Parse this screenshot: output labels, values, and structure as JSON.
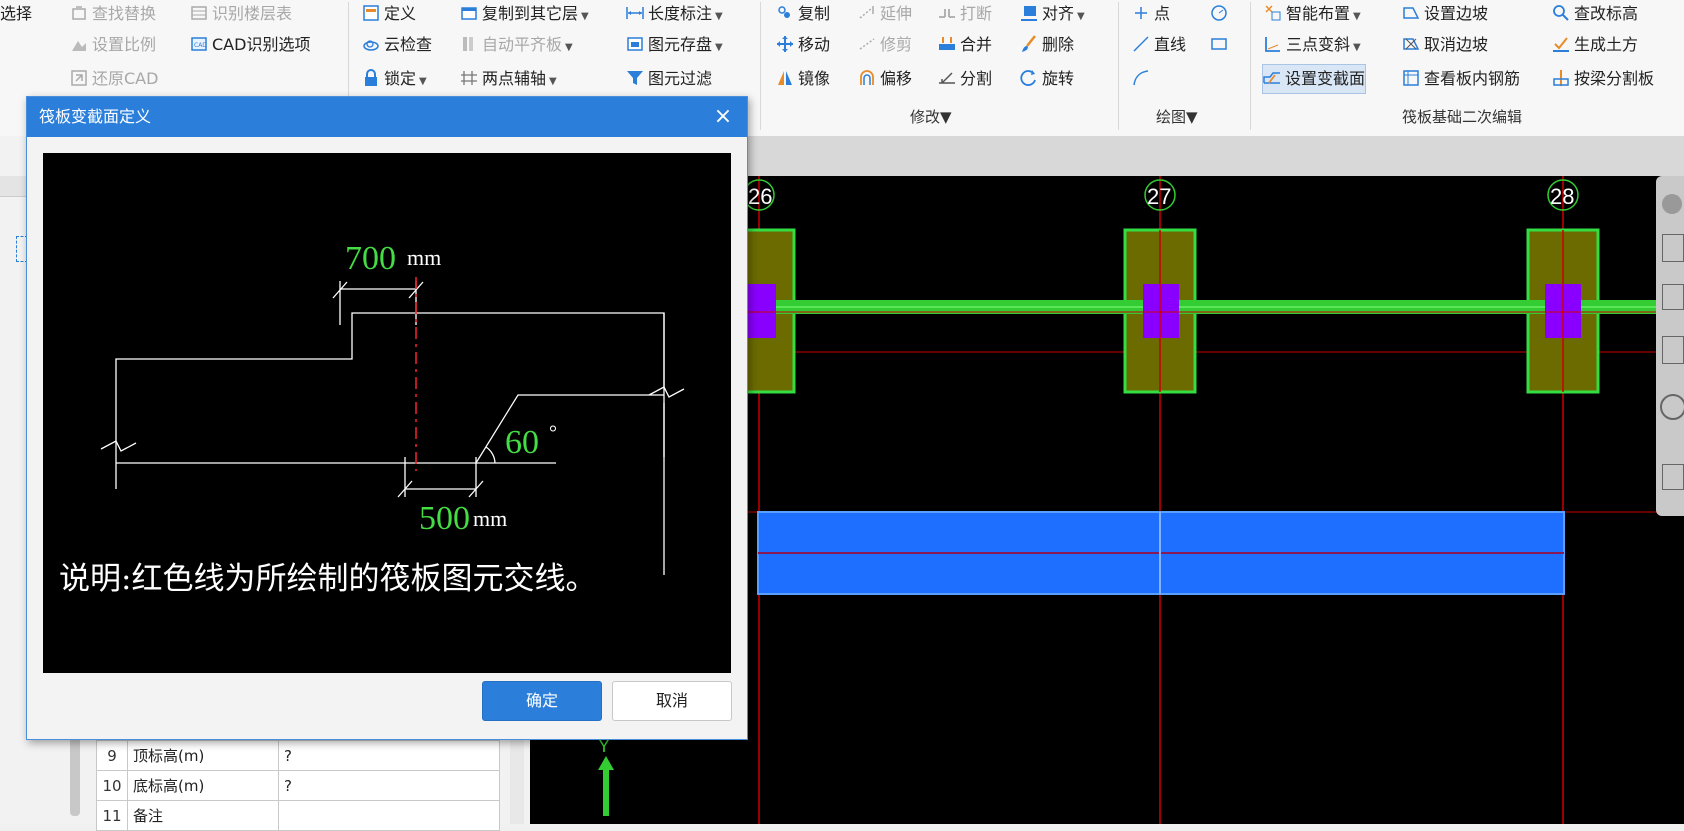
{
  "ribbon": {
    "col1": [
      {
        "label": "选择",
        "disabled": false
      },
      {
        "label": "查找替换",
        "disabled": true
      },
      {
        "label": "设置比例",
        "disabled": true
      },
      {
        "label": "还原CAD",
        "disabled": true
      }
    ],
    "col2": [
      {
        "label": "识别楼层表",
        "disabled": true
      },
      {
        "label": "CAD识别选项",
        "disabled": false
      }
    ],
    "col3": [
      {
        "label": "定义",
        "disabled": false
      },
      {
        "label": "云检查",
        "disabled": false
      },
      {
        "label": "锁定",
        "disabled": false
      }
    ],
    "col4": [
      {
        "label": "复制到其它层",
        "disabled": false
      },
      {
        "label": "自动平齐板",
        "disabled": true
      },
      {
        "label": "两点辅轴",
        "disabled": false
      }
    ],
    "col5": [
      {
        "label": "长度标注",
        "disabled": false
      },
      {
        "label": "图元存盘",
        "disabled": false
      },
      {
        "label": "图元过滤",
        "disabled": false
      }
    ],
    "modify": [
      {
        "label": "复制",
        "disabled": false
      },
      {
        "label": "延伸",
        "disabled": true
      },
      {
        "label": "打断",
        "disabled": true
      },
      {
        "label": "对齐",
        "disabled": false
      },
      {
        "label": "移动",
        "disabled": false
      },
      {
        "label": "修剪",
        "disabled": true
      },
      {
        "label": "合并",
        "disabled": false
      },
      {
        "label": "删除",
        "disabled": false
      },
      {
        "label": "镜像",
        "disabled": false
      },
      {
        "label": "偏移",
        "disabled": false
      },
      {
        "label": "分割",
        "disabled": false
      },
      {
        "label": "旋转",
        "disabled": false
      }
    ],
    "draw": [
      {
        "label": "点"
      },
      {
        "label": "直线"
      }
    ],
    "raft": [
      {
        "label": "智能布置"
      },
      {
        "label": "设置边坡"
      },
      {
        "label": "查改标高"
      },
      {
        "label": "三点变斜"
      },
      {
        "label": "取消边坡"
      },
      {
        "label": "生成土方"
      },
      {
        "label": "设置变截面"
      },
      {
        "label": "查看板内钢筋"
      },
      {
        "label": "按梁分割板"
      }
    ],
    "groups": {
      "modify": "修改",
      "draw": "绘图",
      "raft": "筏板基础二次编辑"
    }
  },
  "props": {
    "rows": [
      {
        "idx": "9",
        "name": "顶标高(m)",
        "value": "?"
      },
      {
        "idx": "10",
        "name": "底标高(m)",
        "value": "?"
      },
      {
        "idx": "11",
        "name": "备注",
        "value": ""
      }
    ]
  },
  "canvas": {
    "axes": [
      "26",
      "27",
      "28"
    ],
    "coord_y": "Y",
    "colors": {
      "beam": "#33cc33",
      "column": "#8a00ff",
      "footing": "#6b6b00",
      "slab": "#1e6fff",
      "gridline": "#cc0000"
    }
  },
  "dialog": {
    "title": "筏板变截面定义",
    "close": "×",
    "dim_top": "700",
    "dim_top_unit": "mm",
    "angle": "60",
    "angle_unit": "°",
    "dim_bottom": "500",
    "dim_bottom_unit": "mm",
    "note": "说明:红色线为所绘制的筏板图元交线。",
    "ok": "确定",
    "cancel": "取消"
  }
}
